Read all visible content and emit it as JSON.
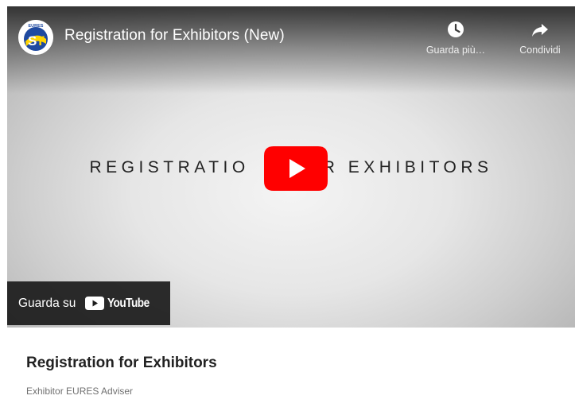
{
  "video": {
    "title": "Registration for Exhibitors (New)",
    "channel_logo_text": "EURES",
    "watch_later_label": "Guarda più…",
    "share_label": "Condividi",
    "center_text_before": "REGISTRATIO",
    "center_text_after": "R EXHIBITORS",
    "watch_on_label": "Guarda su",
    "youtube_wordmark": "YouTube",
    "play_color": "#ff0000"
  },
  "caption": {
    "title": "Registration for Exhibitors",
    "subtitle": "Exhibitor EURES Adviser"
  }
}
